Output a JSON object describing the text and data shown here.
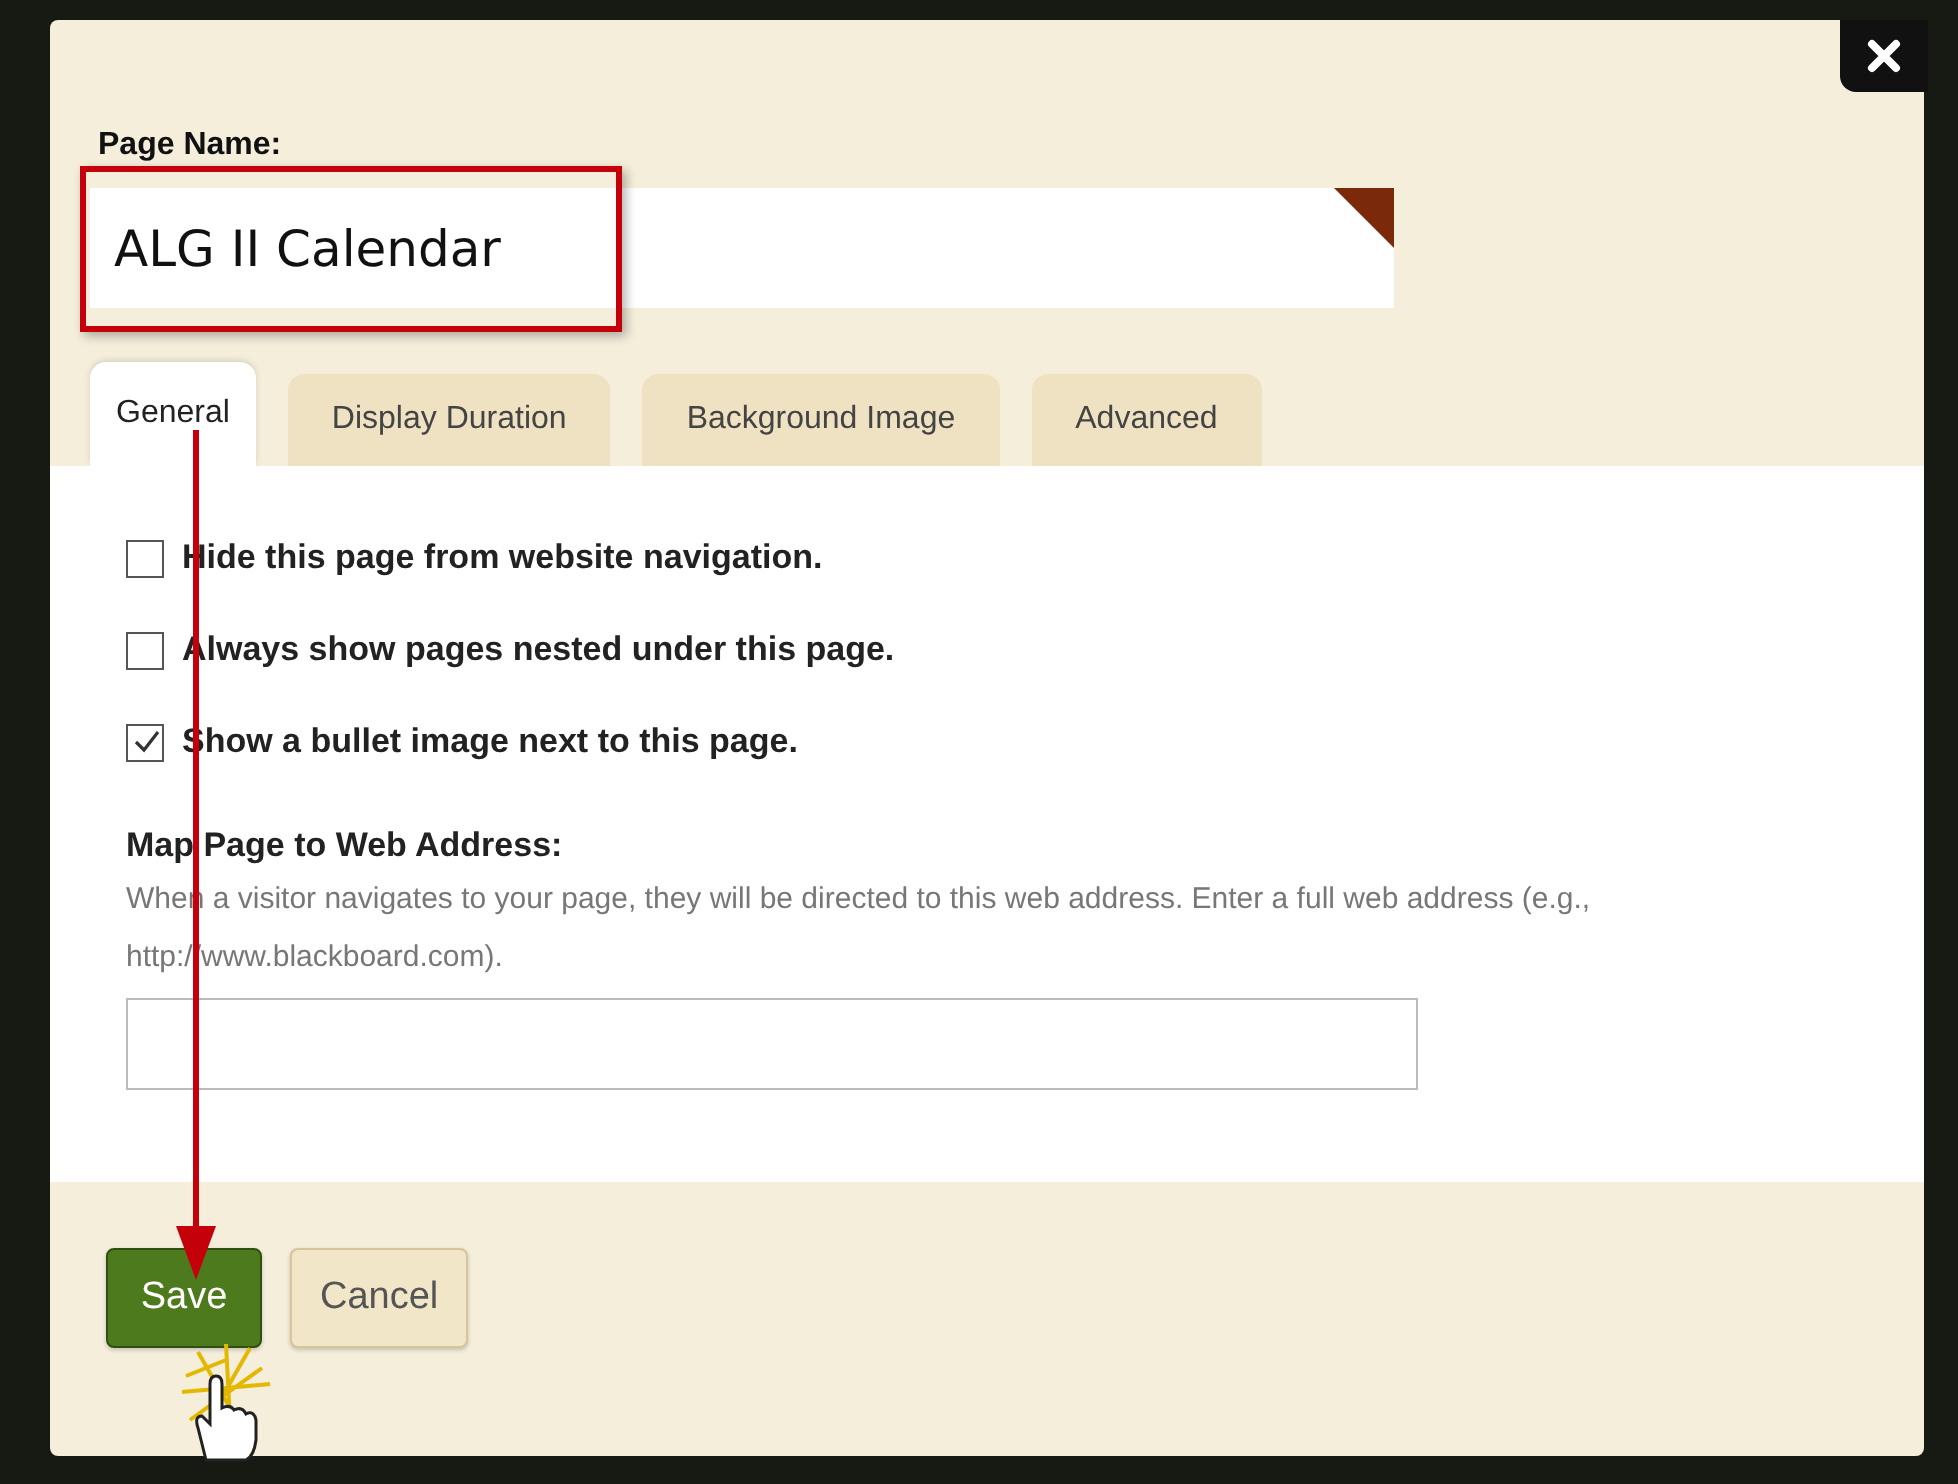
{
  "page_name": {
    "label": "Page Name:",
    "value": "ALG II Calendar"
  },
  "tabs": [
    {
      "label": "General",
      "selected": true
    },
    {
      "label": "Display Duration",
      "selected": false
    },
    {
      "label": "Background Image",
      "selected": false
    },
    {
      "label": "Advanced",
      "selected": false
    }
  ],
  "options": [
    {
      "label": "Hide this page from website navigation.",
      "checked": false
    },
    {
      "label": "Always show pages nested under this page.",
      "checked": false
    },
    {
      "label": "Show a bullet image next to this page.",
      "checked": true
    }
  ],
  "web_address": {
    "label": "Map Page to Web Address:",
    "help": "When a visitor navigates to your page, they will be directed to this web address. Enter a full web address (e.g., http://www.blackboard.com)."
  },
  "buttons": [
    {
      "label": "Save",
      "kind": "primary"
    },
    {
      "label": "Cancel",
      "kind": "secondary"
    }
  ]
}
